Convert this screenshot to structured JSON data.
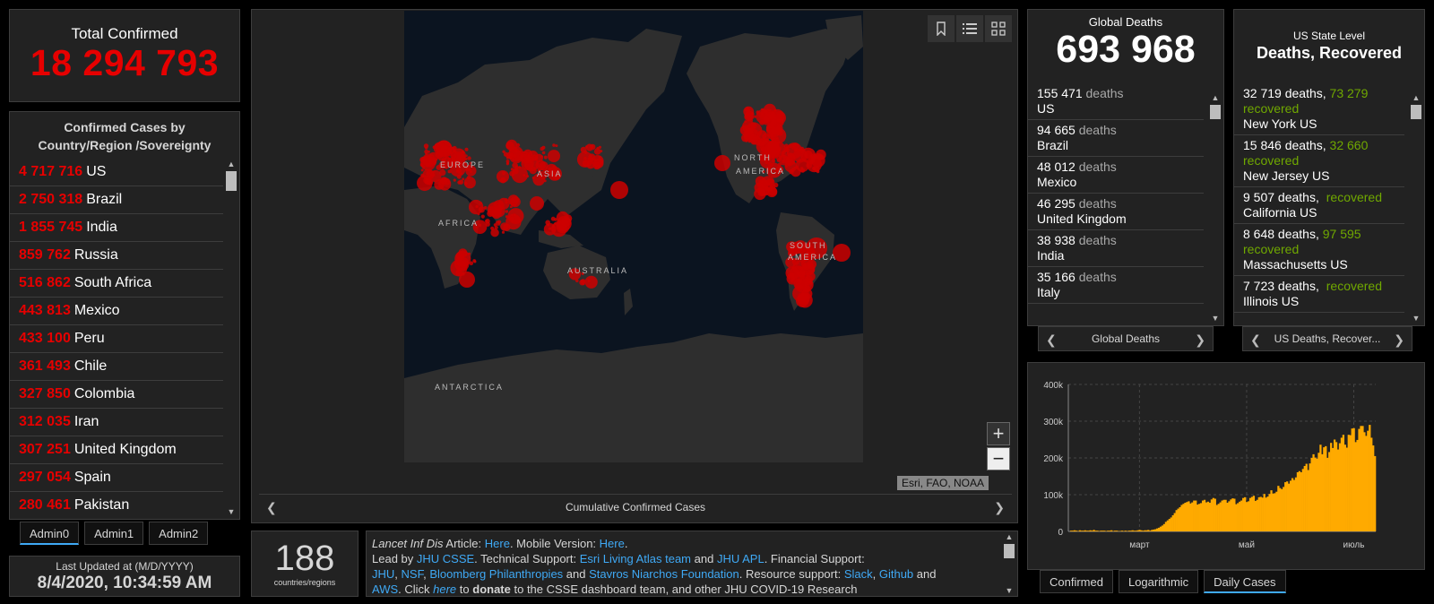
{
  "total": {
    "label": "Total Confirmed",
    "value": "18 294 793"
  },
  "country_list": {
    "header": "Confirmed Cases by Country/Region /Sovereignty",
    "items": [
      {
        "value": "4 717 716",
        "name": "US"
      },
      {
        "value": "2 750 318",
        "name": "Brazil"
      },
      {
        "value": "1 855 745",
        "name": "India"
      },
      {
        "value": "859 762",
        "name": "Russia"
      },
      {
        "value": "516 862",
        "name": "South Africa"
      },
      {
        "value": "443 813",
        "name": "Mexico"
      },
      {
        "value": "433 100",
        "name": "Peru"
      },
      {
        "value": "361 493",
        "name": "Chile"
      },
      {
        "value": "327 850",
        "name": "Colombia"
      },
      {
        "value": "312 035",
        "name": "Iran"
      },
      {
        "value": "307 251",
        "name": "United Kingdom"
      },
      {
        "value": "297 054",
        "name": "Spain"
      },
      {
        "value": "280 461",
        "name": "Pakistan"
      }
    ]
  },
  "admin_tabs": [
    "Admin0",
    "Admin1",
    "Admin2"
  ],
  "last_updated": {
    "label": "Last Updated at (M/D/YYYY)",
    "value": "8/4/2020, 10:34:59 AM"
  },
  "map": {
    "labels": [
      "EUROPE",
      "ASIA",
      "AFRICA",
      "AUSTRALIA",
      "NORTH",
      "AMERICA",
      "SOUTH",
      "AMERICA",
      "ANTARCTICA"
    ],
    "attribution": "Esri, FAO, NOAA",
    "footer": "Cumulative Confirmed Cases",
    "zoom_in": "+",
    "zoom_out": "−",
    "colors": {
      "ocean": "#0b1420",
      "land": "#2e2e2e",
      "case": "#cc0000"
    }
  },
  "countries_count": {
    "value": "188",
    "label": "countries/regions"
  },
  "info": {
    "line1_a": "Lancet Inf Dis",
    "line1_b": " Article: ",
    "here1": "Here",
    "line1_c": ". Mobile Version: ",
    "here2": "Here",
    "line1_d": ".",
    "lead": "Lead by ",
    "jhu_csse": "JHU CSSE",
    "tech": ". Technical Support: ",
    "esri": "Esri Living Atlas team",
    "and1": " and ",
    "jhu_apl": "JHU APL",
    "fin": ". Financial Support:",
    "jhu": "JHU",
    "comma1": ", ",
    "nsf": "NSF",
    "comma2": ", ",
    "bloomberg": "Bloomberg Philanthropies",
    "and2": " and ",
    "stavros": "Stavros Niarchos Foundation",
    "res": ". Resource support: ",
    "slack": "Slack",
    "comma3": ", ",
    "github": "Github",
    "and3": " and",
    "aws": "AWS",
    "click": ". Click ",
    "here3": "here",
    "to": " to ",
    "donate": "donate",
    "rest": " to the CSSE dashboard team, and other JHU COVID-19 Research"
  },
  "deaths": {
    "label": "Global Deaths",
    "value": "693 968",
    "items": [
      {
        "count": "155 471",
        "unit": "deaths",
        "place": "US"
      },
      {
        "count": "94 665",
        "unit": "deaths",
        "place": "Brazil"
      },
      {
        "count": "48 012",
        "unit": "deaths",
        "place": "Mexico"
      },
      {
        "count": "46 295",
        "unit": "deaths",
        "place": "United Kingdom"
      },
      {
        "count": "38 938",
        "unit": "deaths",
        "place": "India"
      },
      {
        "count": "35 166",
        "unit": "deaths",
        "place": "Italy"
      }
    ],
    "footer": "Global Deaths"
  },
  "states": {
    "label": "US State Level",
    "title": "Deaths, Recovered",
    "items": [
      {
        "deaths": "32 719 deaths,",
        "recovered": "73 279",
        "rec_label": "recovered",
        "place": "New York US"
      },
      {
        "deaths": "15 846 deaths,",
        "recovered": "32 660",
        "rec_label": "recovered",
        "place": "New Jersey US"
      },
      {
        "deaths": "9 507 deaths,",
        "recovered": "",
        "rec_label": "recovered",
        "place": "California US"
      },
      {
        "deaths": "8 648 deaths,",
        "recovered": "97 595",
        "rec_label": "recovered",
        "place": "Massachusetts US"
      },
      {
        "deaths": "7 723 deaths,",
        "recovered": "",
        "rec_label": "recovered",
        "place": "Illinois US"
      }
    ],
    "footer": "US Deaths, Recover..."
  },
  "chart_tabs": [
    "Confirmed",
    "Logarithmic",
    "Daily Cases"
  ],
  "chart_data": {
    "type": "bar",
    "y_ticks": [
      "0",
      "100k",
      "200k",
      "300k",
      "400k"
    ],
    "ylim": [
      0,
      400000
    ],
    "x_ticks": [
      {
        "label": "март",
        "index": 40
      },
      {
        "label": "май",
        "index": 101
      },
      {
        "label": "июль",
        "index": 162
      }
    ],
    "color": "#ffaa00",
    "values": [
      0,
      2000,
      2000,
      3000,
      2000,
      1000,
      3000,
      2000,
      2000,
      3000,
      2000,
      2000,
      3000,
      2000,
      4000,
      2000,
      2000,
      1000,
      2000,
      2000,
      2000,
      1000,
      2000,
      2000,
      3000,
      1000,
      2000,
      2000,
      1000,
      1000,
      2000,
      1000,
      2000,
      1000,
      2000,
      2000,
      3000,
      2000,
      2000,
      3000,
      4000,
      3000,
      2000,
      3000,
      3000,
      4000,
      2000,
      4000,
      5000,
      6000,
      8000,
      10000,
      13000,
      16000,
      20000,
      26000,
      30000,
      34000,
      38000,
      44000,
      50000,
      58000,
      62000,
      66000,
      72000,
      75000,
      78000,
      80000,
      82000,
      76000,
      79000,
      84000,
      84000,
      73000,
      75000,
      77000,
      84000,
      86000,
      79000,
      81000,
      78000,
      87000,
      91000,
      89000,
      72000,
      75000,
      79000,
      84000,
      86000,
      86000,
      78000,
      82000,
      87000,
      90000,
      89000,
      74000,
      77000,
      81000,
      84000,
      91000,
      93000,
      80000,
      82000,
      91000,
      94000,
      97000,
      83000,
      86000,
      93000,
      94000,
      92000,
      102000,
      92000,
      95000,
      102000,
      112000,
      103000,
      104000,
      108000,
      124000,
      118000,
      115000,
      121000,
      134000,
      136000,
      130000,
      138000,
      145000,
      140000,
      147000,
      161000,
      164000,
      161000,
      170000,
      178000,
      184000,
      167000,
      185000,
      200000,
      210000,
      201000,
      198000,
      214000,
      236000,
      210000,
      229000,
      232000,
      200000,
      216000,
      241000,
      227000,
      250000,
      243000,
      223000,
      240000,
      255000,
      263000,
      236000,
      228000,
      263000,
      262000,
      280000,
      281000,
      243000,
      249000,
      279000,
      287000,
      287000,
      270000,
      260000,
      274000,
      290000,
      255000,
      234000,
      205000
    ]
  }
}
